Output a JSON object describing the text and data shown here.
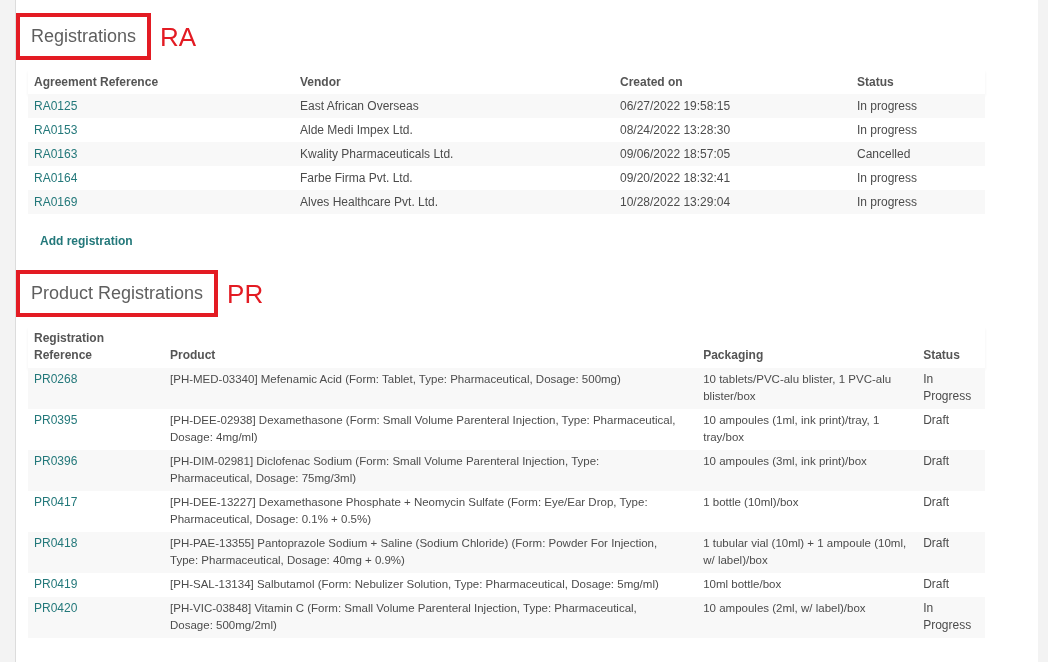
{
  "registrations": {
    "title": "Registrations",
    "annotation": "RA",
    "columns": [
      "Agreement Reference",
      "Vendor",
      "Created on",
      "Status"
    ],
    "rows": [
      {
        "reference": "RA0125",
        "vendor": "East African Overseas",
        "created_on": "06/27/2022 19:58:15",
        "status": "In progress"
      },
      {
        "reference": "RA0153",
        "vendor": "Alde Medi Impex Ltd.",
        "created_on": "08/24/2022 13:28:30",
        "status": "In progress"
      },
      {
        "reference": "RA0163",
        "vendor": "Kwality Pharmaceuticals Ltd.",
        "created_on": "09/06/2022 18:57:05",
        "status": "Cancelled"
      },
      {
        "reference": "RA0164",
        "vendor": "Farbe Firma Pvt. Ltd.",
        "created_on": "09/20/2022 18:32:41",
        "status": "In progress"
      },
      {
        "reference": "RA0169",
        "vendor": "Alves Healthcare Pvt. Ltd.",
        "created_on": "10/28/2022 13:29:04",
        "status": "In progress"
      }
    ],
    "add_link": "Add registration"
  },
  "product_registrations": {
    "title": "Product Registrations",
    "annotation": "PR",
    "columns": [
      "Registration Reference",
      "Product",
      "Packaging",
      "Status"
    ],
    "rows": [
      {
        "reference": "PR0268",
        "product": "[PH-MED-03340] Mefenamic Acid (Form: Tablet, Type: Pharmaceutical, Dosage: 500mg)",
        "packaging": "10 tablets/PVC-alu blister, 1 PVC-alu blister/box",
        "status": "In Progress"
      },
      {
        "reference": "PR0395",
        "product": "[PH-DEE-02938] Dexamethasone (Form: Small Volume Parenteral Injection, Type: Pharmaceutical, Dosage: 4mg/ml)",
        "packaging": "10 ampoules (1ml, ink print)/tray, 1 tray/box",
        "status": "Draft"
      },
      {
        "reference": "PR0396",
        "product": "[PH-DIM-02981] Diclofenac Sodium (Form: Small Volume Parenteral Injection, Type: Pharmaceutical, Dosage: 75mg/3ml)",
        "packaging": "10 ampoules (3ml, ink print)/box",
        "status": "Draft"
      },
      {
        "reference": "PR0417",
        "product": "[PH-DEE-13227] Dexamethasone Phosphate + Neomycin Sulfate (Form: Eye/Ear Drop, Type: Pharmaceutical, Dosage: 0.1% + 0.5%)",
        "packaging": "1 bottle (10ml)/box",
        "status": "Draft"
      },
      {
        "reference": "PR0418",
        "product": "[PH-PAE-13355] Pantoprazole Sodium + Saline (Sodium Chloride) (Form: Powder For Injection, Type: Pharmaceutical, Dosage: 40mg + 0.9%)",
        "packaging": "1 tubular vial (10ml) + 1 ampoule (10ml, w/ label)/box",
        "status": "Draft"
      },
      {
        "reference": "PR0419",
        "product": "[PH-SAL-13134] Salbutamol (Form: Nebulizer Solution, Type: Pharmaceutical, Dosage: 5mg/ml)",
        "packaging": "10ml bottle/box",
        "status": "Draft"
      },
      {
        "reference": "PR0420",
        "product": "[PH-VIC-03848] Vitamin C (Form: Small Volume Parenteral Injection, Type: Pharmaceutical, Dosage: 500mg/2ml)",
        "packaging": "10 ampoules (2ml, w/ label)/box",
        "status": "In Progress"
      }
    ]
  }
}
